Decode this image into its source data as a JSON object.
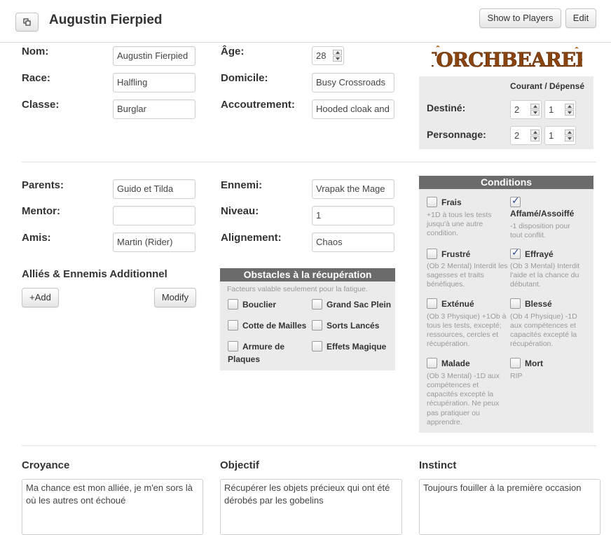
{
  "header": {
    "title": "Augustin Fierpied",
    "show_players_label": "Show to Players",
    "edit_label": "Edit"
  },
  "identity": {
    "nom": {
      "label": "Nom:",
      "value": "Augustin Fierpied"
    },
    "race": {
      "label": "Race:",
      "value": "Halfling"
    },
    "classe": {
      "label": "Classe:",
      "value": "Burglar"
    },
    "age": {
      "label": "Âge:",
      "value": "28"
    },
    "domicile": {
      "label": "Domicile:",
      "value": "Busy Crossroads"
    },
    "accoutrement": {
      "label": "Accoutrement:",
      "value": "Hooded cloak and"
    }
  },
  "logo": {
    "text": "TORCHBEARER",
    "color": "#8a4410"
  },
  "points": {
    "header": "Courant / Dépensé",
    "destine": {
      "label": "Destiné:",
      "courant": "2",
      "depense": "1"
    },
    "personnage": {
      "label": "Personnage:",
      "courant": "2",
      "depense": "1"
    }
  },
  "relations": {
    "parents": {
      "label": "Parents:",
      "value": "Guido et Tilda"
    },
    "mentor": {
      "label": "Mentor:",
      "value": ""
    },
    "amis": {
      "label": "Amis:",
      "value": "Martin (Rider)"
    },
    "ennemi": {
      "label": "Ennemi:",
      "value": "Vrapak the Mage"
    },
    "niveau": {
      "label": "Niveau:",
      "value": "1"
    },
    "alignement": {
      "label": "Alignement:",
      "value": "Chaos"
    }
  },
  "allies": {
    "title": "Alliés & Ennemis Additionnel",
    "add_label": "+Add",
    "modify_label": "Modify"
  },
  "obstacles": {
    "title": "Obstacles à la récupération",
    "note": "Facteurs valable seulement pour la fatigue.",
    "items": [
      {
        "label": "Bouclier",
        "checked": false
      },
      {
        "label": "Grand Sac Plein",
        "checked": false
      },
      {
        "label": "Cotte de Mailles",
        "checked": false
      },
      {
        "label": "Sorts Lancés",
        "checked": false
      },
      {
        "label": "Armure de",
        "label2": "Plaques",
        "checked": false
      },
      {
        "label": "Effets Magique",
        "checked": false
      }
    ]
  },
  "conditions": {
    "title": "Conditions",
    "items": [
      {
        "label": "Frais",
        "checked": false,
        "l1": "+1D à tous les tests",
        "l2": "jusqu'à une autre",
        "l3": "condition."
      },
      {
        "label": "Affamé/Assoiffé",
        "checked": true,
        "l1": "-1 disposition pour",
        "l2": "tout conflit."
      },
      {
        "label": "Frustré",
        "checked": false,
        "l1": "(Ob 2 Mental) Interdit les",
        "l2": "sagesses et traits",
        "l3": "bénéfiques."
      },
      {
        "label": "Effrayé",
        "checked": true,
        "l1": "(Ob 3 Mental) Interdit",
        "l2": "l'aide et la chance du",
        "l3": "débutant."
      },
      {
        "label": "Exténué",
        "checked": false,
        "l1": "(Ob 3 Physique) +1Ob à",
        "l2": "tous les tests, excepté;",
        "l3": "ressources, cercles et",
        "l4": "récupération."
      },
      {
        "label": "Blessé",
        "checked": false,
        "l1": "(Ob 4 Physique) -1D",
        "l2": "aux compétences et",
        "l3": "capacités excepté la",
        "l4": "récupération."
      },
      {
        "label": "Malade",
        "checked": false,
        "l1": "(Ob 3 Mental) -1D aux",
        "l2": "compétences et",
        "l3": "capacités excepté la",
        "l4": "récupération. Ne peux",
        "l5": "pas pratiquer ou",
        "l6": "apprendre."
      },
      {
        "label": "Mort",
        "checked": false,
        "l1": "RIP"
      }
    ]
  },
  "beliefs": {
    "croyance": {
      "label": "Croyance",
      "l1": "Ma chance est mon alliée, je m'en sors là",
      "l2": "où les autres ont échoué"
    },
    "objectif": {
      "label": "Objectif",
      "l1": "Récupérer les objets précieux qui ont été",
      "l2": "dérobés par les gobelins"
    },
    "instinct": {
      "label": "Instinct",
      "l1": "Toujours fouiller à la première occasion"
    }
  }
}
